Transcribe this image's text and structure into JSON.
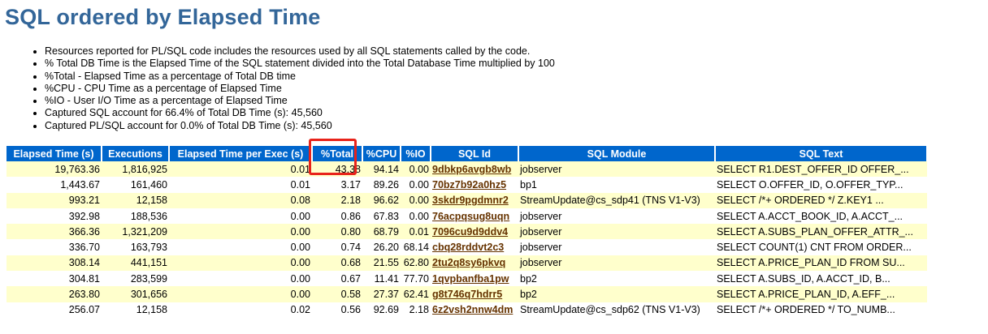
{
  "title": "SQL ordered by Elapsed Time",
  "notes": [
    "Resources reported for PL/SQL code includes the resources used by all SQL statements called by the code.",
    "% Total DB Time is the Elapsed Time of the SQL statement divided into the Total Database Time multiplied by 100",
    "%Total - Elapsed Time as a percentage of Total DB time",
    "%CPU - CPU Time as a percentage of Elapsed Time",
    "%IO - User I/O Time as a percentage of Elapsed Time",
    "Captured SQL account for 66.4% of Total DB Time (s): 45,560",
    "Captured PL/SQL account for 0.0% of Total DB Time (s): 45,560"
  ],
  "columns": [
    "Elapsed Time (s)",
    "Executions",
    "Elapsed Time per Exec (s)",
    "%Total",
    "%CPU",
    "%IO",
    "SQL Id",
    "SQL Module",
    "SQL Text"
  ],
  "rows": [
    [
      "19,763.36",
      "1,816,925",
      "0.01",
      "43.38",
      "94.14",
      "0.00",
      "9dbkp6avgb8wb",
      "jobserver",
      "SELECT R1.DEST_OFFER_ID OFFER_..."
    ],
    [
      "1,443.67",
      "161,460",
      "0.01",
      "3.17",
      "89.26",
      "0.00",
      "70bz7b92a0hz5",
      "bp1",
      "SELECT O.OFFER_ID, O.OFFER_TYP..."
    ],
    [
      "993.21",
      "12,158",
      "0.08",
      "2.18",
      "96.62",
      "0.00",
      "3skdr9pgdmnr2",
      "StreamUpdate@cs_sdp41 (TNS V1-V3)",
      "SELECT /*+ ORDERED */ Z.KEY1 ..."
    ],
    [
      "392.98",
      "188,536",
      "0.00",
      "0.86",
      "67.83",
      "0.00",
      "76acpqsug8uqn",
      "jobserver",
      "SELECT A.ACCT_BOOK_ID, A.ACCT_..."
    ],
    [
      "366.36",
      "1,321,209",
      "0.00",
      "0.80",
      "68.79",
      "0.01",
      "7096cu9d9ddv4",
      "jobserver",
      "SELECT A.SUBS_PLAN_OFFER_ATTR_..."
    ],
    [
      "336.70",
      "163,793",
      "0.00",
      "0.74",
      "26.20",
      "68.14",
      "cbq28rddvt2c3",
      "jobserver",
      "SELECT COUNT(1) CNT FROM ORDER..."
    ],
    [
      "308.14",
      "441,151",
      "0.00",
      "0.68",
      "21.55",
      "62.80",
      "2tu2q8sy6pkvq",
      "jobserver",
      "SELECT A.PRICE_PLAN_ID FROM SU..."
    ],
    [
      "304.81",
      "283,599",
      "0.00",
      "0.67",
      "11.41",
      "77.70",
      "1qvpbanfba1pw",
      "bp2",
      "SELECT A.SUBS_ID, A.ACCT_ID, B..."
    ],
    [
      "263.80",
      "301,656",
      "0.00",
      "0.58",
      "27.37",
      "62.41",
      "g8t746q7hdrr5",
      "bp2",
      "SELECT A.PRICE_PLAN_ID, A.EFF_..."
    ],
    [
      "256.07",
      "12,158",
      "0.02",
      "0.56",
      "92.69",
      "2.18",
      "6z2vsh2nnw4dm",
      "StreamUpdate@cs_sdp62 (TNS V1-V3)",
      "SELECT /*+ ORDERED */ TO_NUMB..."
    ]
  ],
  "colors": {
    "title": "#336699",
    "header_bg": "#0066cc",
    "row_odd_bg": "#ffffcc",
    "link": "#663300",
    "highlight_box": "#e8231a"
  }
}
